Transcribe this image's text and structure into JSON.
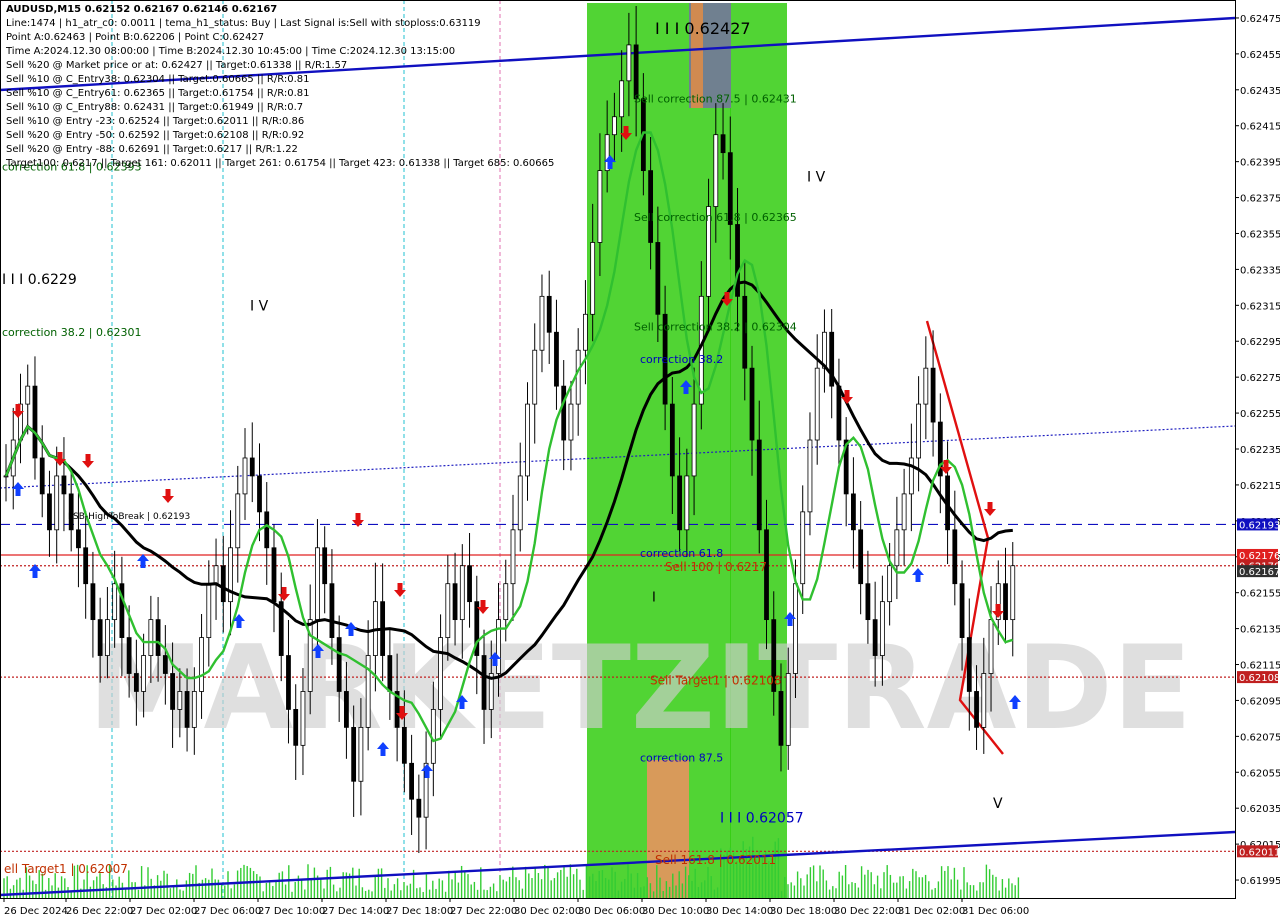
{
  "chart_data": {
    "type": "candlestick",
    "symbol_line": "AUDUSD,M15  0.62152 0.62167 0.62146 0.62167",
    "info_lines": [
      "Line:1474  |  h1_atr_c0: 0.0011  |  tema_h1_status: Buy  |  Last Signal is:Sell with stoploss:0.63119",
      "Point A:0.62463  |  Point B:0.62206  |  Point C:0.62427",
      "Time A:2024.12.30 08:00:00  |  Time B:2024.12.30 10:45:00  |  Time C:2024.12.30 13:15:00",
      "Sell %20 @ Market price or at: 0.62427  ||  Target:0.61338  ||  R/R:1.57",
      "Sell %10 @ C_Entry38: 0.62304  ||  Target:0.60665  ||  R/R:0.81",
      "Sell %10 @ C_Entry61: 0.62365  ||  Target:0.61754  ||  R/R:0.81",
      "Sell %10 @ C_Entry88: 0.62431  ||  Target:0.61949  ||  R/R:0.7",
      "Sell %10 @ Entry -23: 0.62524  ||  Target:0.62011  ||  R/R:0.86",
      "Sell %20 @ Entry -50: 0.62592  ||  Target:0.62108  ||  R/R:0.92",
      "Sell %20 @ Entry -88: 0.62691  ||  Target:0.6217  ||  R/R:1.22",
      "Target100: 0.6217  ||  Target 161: 0.62011  ||  Target 261: 0.61754  ||  Target 423: 0.61338  ||  Target 685: 0.60665"
    ],
    "y_ticks": [
      "0.62475",
      "0.62455",
      "0.62435",
      "0.62415",
      "0.62395",
      "0.62375",
      "0.62355",
      "0.62335",
      "0.62315",
      "0.62295",
      "0.62275",
      "0.62255",
      "0.62235",
      "0.62215",
      "0.62195",
      "0.62175",
      "0.62155",
      "0.62135",
      "0.62115",
      "0.62095",
      "0.62075",
      "0.62055",
      "0.62035",
      "0.62015",
      "0.61995"
    ],
    "x_ticks": [
      "26 Dec 2024",
      "26 Dec 22:00",
      "27 Dec 02:00",
      "27 Dec 06:00",
      "27 Dec 10:00",
      "27 Dec 14:00",
      "27 Dec 18:00",
      "27 Dec 22:00",
      "30 Dec 02:00",
      "30 Dec 06:00",
      "30 Dec 10:00",
      "30 Dec 14:00",
      "30 Dec 18:00",
      "30 Dec 22:00",
      "31 Dec 02:00",
      "31 Dec 06:00"
    ],
    "ylim": [
      0.61985,
      0.62485
    ],
    "price_tags": [
      {
        "value": 0.62193,
        "text": "0.62193",
        "color": "#1010c0"
      },
      {
        "value": 0.62176,
        "text": "0.62176",
        "color": "#e02020"
      },
      {
        "value": 0.6217,
        "text": "0.62170",
        "color": "#c02020"
      },
      {
        "value": 0.62167,
        "text": "0.62167",
        "color": "#303030"
      },
      {
        "value": 0.62108,
        "text": "0.62108",
        "color": "#c02020"
      },
      {
        "value": 0.62011,
        "text": "0.62011",
        "color": "#c02020"
      }
    ],
    "annotations": [
      {
        "text": "I I I  0.62427",
        "value": 0.62466,
        "color": "#000000",
        "size": 16
      },
      {
        "text": "Sell correction 87.5 | 0.62431",
        "value": 0.62428,
        "color": "#006000",
        "size": 11
      },
      {
        "text": "Sell correction 61.8 | 0.62365",
        "value": 0.62362,
        "color": "#006000",
        "size": 11
      },
      {
        "text": "Sell correction 38.2 | 0.62304",
        "value": 0.62301,
        "color": "#006000",
        "size": 11
      },
      {
        "text": "correction 61.8 | 0.62393",
        "value": 0.6239,
        "color": "#006000",
        "size": 11
      },
      {
        "text": "correction 38.2 | 0.62301",
        "value": 0.62298,
        "color": "#006000",
        "size": 11
      },
      {
        "text": "I I I  0.6229",
        "value": 0.62327,
        "color": "#000000",
        "size": 14
      },
      {
        "text": "I V",
        "value": 0.62312,
        "color": "#000000",
        "size": 14
      },
      {
        "text": "I V",
        "value": 0.62384,
        "color": "#000000",
        "size": 14
      },
      {
        "text": "correction 38.2",
        "value": 0.62283,
        "color": "#0000c0",
        "size": 11
      },
      {
        "text": "correction 61.8",
        "value": 0.62175,
        "color": "#0000c0",
        "size": 11
      },
      {
        "text": "Sell 100 | 0.6217",
        "value": 0.62167,
        "color": "#c03000",
        "size": 12
      },
      {
        "text": "I",
        "value": 0.6215,
        "color": "#000000",
        "size": 13
      },
      {
        "text": "Sell Target1 | 0.62108",
        "value": 0.62104,
        "color": "#c03000",
        "size": 12
      },
      {
        "text": "correction 87.5",
        "value": 0.62061,
        "color": "#0000c0",
        "size": 11
      },
      {
        "text": "I I I  0.62057",
        "value": 0.62027,
        "color": "#0000c0",
        "size": 14
      },
      {
        "text": "V",
        "value": 0.62035,
        "color": "#000000",
        "size": 14
      },
      {
        "text": "Sell 161.8 | 0.62011",
        "value": 0.62004,
        "color": "#c03000",
        "size": 12
      },
      {
        "text": "ell Target1 | 0.62007",
        "value": 0.61999,
        "color": "#c03000",
        "size": 12
      },
      {
        "text": "FSB-HighToBreak | 0.62193",
        "value": 0.62196,
        "color": "#000000",
        "size": 9
      }
    ],
    "horizontal_lines": [
      {
        "value": 0.62193,
        "color": "#1010c0",
        "style": "dashed"
      },
      {
        "value": 0.62176,
        "color": "#e02020",
        "style": "solid"
      },
      {
        "value": 0.6217,
        "color": "#c02020",
        "style": "dotted"
      },
      {
        "value": 0.62108,
        "color": "#c02020",
        "style": "dotted"
      },
      {
        "value": 0.62011,
        "color": "#c02020",
        "style": "dotted"
      }
    ],
    "watermark": "MARKETZITRADE",
    "grid": false,
    "candles_approx": [
      0.6222,
      0.6224,
      0.6226,
      0.6227,
      0.6223,
      0.6221,
      0.6219,
      0.6222,
      0.6221,
      0.6219,
      0.6218,
      0.6216,
      0.6214,
      0.6212,
      0.6214,
      0.6216,
      0.6213,
      0.6211,
      0.621,
      0.6212,
      0.6214,
      0.6212,
      0.6211,
      0.6209,
      0.621,
      0.6208,
      0.621,
      0.6213,
      0.6216,
      0.6217,
      0.6215,
      0.6218,
      0.6221,
      0.6223,
      0.6222,
      0.622,
      0.6218,
      0.6215,
      0.6212,
      0.6209,
      0.6207,
      0.621,
      0.6214,
      0.6218,
      0.6216,
      0.6213,
      0.621,
      0.6208,
      0.6205,
      0.6208,
      0.6212,
      0.6215,
      0.6212,
      0.621,
      0.6208,
      0.6206,
      0.6204,
      0.6203,
      0.6206,
      0.6209,
      0.6213,
      0.6216,
      0.6214,
      0.6217,
      0.6215,
      0.6212,
      0.6209,
      0.6211,
      0.6214,
      0.6216,
      0.6219,
      0.6222,
      0.6226,
      0.6229,
      0.6232,
      0.623,
      0.6227,
      0.6224,
      0.6226,
      0.6229,
      0.6231,
      0.6235,
      0.6239,
      0.6241,
      0.6242,
      0.6244,
      0.6246,
      0.6243,
      0.6239,
      0.6235,
      0.6231,
      0.6226,
      0.6222,
      0.6219,
      0.6222,
      0.6226,
      0.6232,
      0.6237,
      0.6241,
      0.624,
      0.6236,
      0.6232,
      0.6228,
      0.6224,
      0.6219,
      0.6214,
      0.621,
      0.6207,
      0.6211,
      0.6216,
      0.622,
      0.6224,
      0.6228,
      0.623,
      0.6227,
      0.6224,
      0.6221,
      0.6219,
      0.6216,
      0.6214,
      0.6212,
      0.6215,
      0.6217,
      0.6219,
      0.6221,
      0.6223,
      0.6226,
      0.6228,
      0.6225,
      0.6222,
      0.6219,
      0.6216,
      0.6213,
      0.621,
      0.6208,
      0.6211,
      0.6214,
      0.6216,
      0.6214,
      0.6217
    ]
  }
}
